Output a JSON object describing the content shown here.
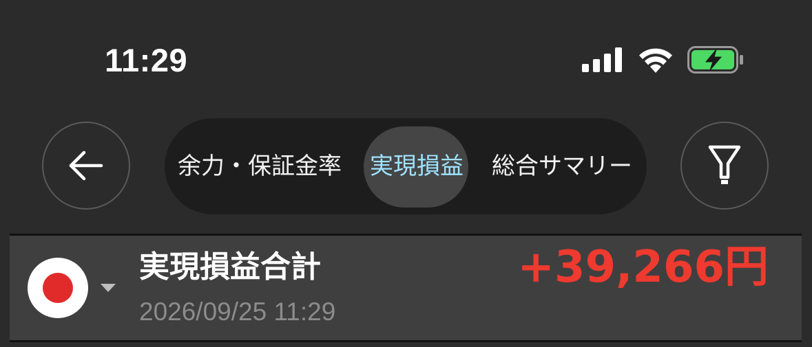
{
  "status_bar": {
    "time": "11:29",
    "icons": [
      "cellular-signal-icon",
      "wifi-icon",
      "battery-charging-icon"
    ]
  },
  "nav": {
    "back_icon": "arrow-left-icon",
    "filter_icon": "filter-icon",
    "tabs": [
      {
        "label": "余力・保証金率",
        "selected": false
      },
      {
        "label": "実現損益",
        "selected": true
      },
      {
        "label": "総合サマリー",
        "selected": false
      }
    ]
  },
  "summary": {
    "flag_icon": "japan-flag-icon",
    "title": "実現損益合計",
    "date": "2026/09/25 11:29",
    "amount": "+39,266円"
  },
  "colors": {
    "background": "#2b2b2b",
    "segment_bg": "#1d1d1d",
    "selected_pill": "#454545",
    "selected_text": "#9fe3ff",
    "profit_red": "#ee3a2f",
    "battery_green": "#4cd964"
  }
}
